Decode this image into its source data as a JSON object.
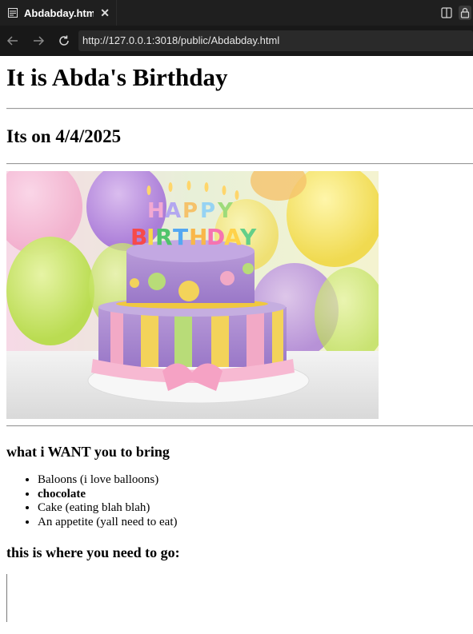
{
  "browser": {
    "tab_title": "Abdabday.html",
    "url": "http://127.0.0.1:3018/public/Abdabday.html"
  },
  "page": {
    "heading": "It is Abda's Birthday",
    "date_heading": "Its on 4/4/2025",
    "bring_heading": "what i WANT you to bring",
    "bring_items": [
      {
        "text": "Baloons (i love balloons)"
      },
      {
        "text": "chocolate"
      },
      {
        "text": "Cake (eating blah blah)"
      },
      {
        "text": "An appetite (yall need to eat)"
      }
    ],
    "directions_heading": "this is where you need to go:"
  },
  "image": {
    "cake_topper_text": "HAPPY BIRTHDAY"
  },
  "colors": {
    "tabbar_bg": "#1f1f1f",
    "navbar_bg": "#181818",
    "addressbar_bg": "#2a2a2a"
  }
}
